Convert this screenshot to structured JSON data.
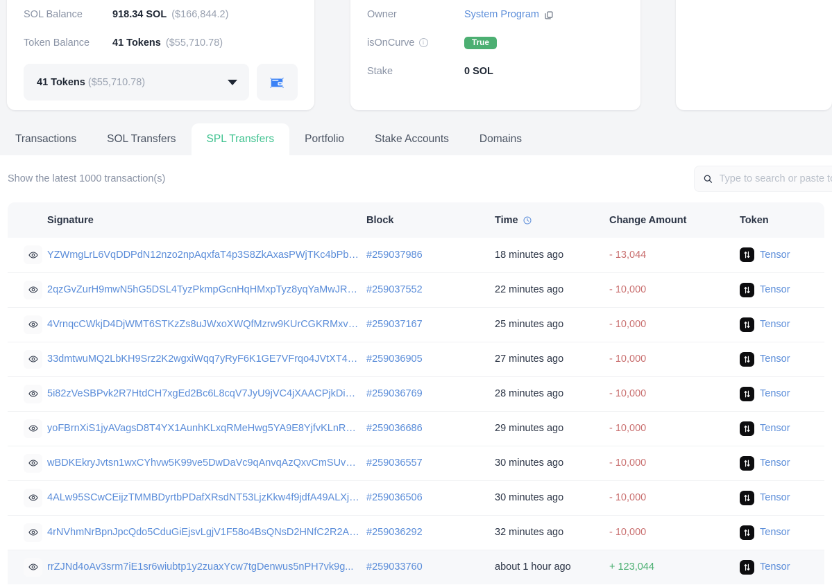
{
  "account_card": {
    "rows": [
      {
        "label": "SOL Balance",
        "value_strong": "918.34 SOL",
        "value_muted": "($166,844.2)"
      },
      {
        "label": "Token Balance",
        "value_strong": "41 Tokens",
        "value_muted": "($55,710.78)"
      }
    ],
    "token_selector": {
      "value_strong": "41 Tokens",
      "value_muted": "($55,710.78)",
      "caret_icon": "chevron-down-icon",
      "wallet_icon": "wallet-icon"
    }
  },
  "detail_card": {
    "owner_label": "Owner",
    "owner_value": "System Program",
    "owner_copy_icon": "copy-icon",
    "isoncurve_label": "isOnCurve",
    "isoncurve_info_icon": "info-icon",
    "isoncurve_value": "True",
    "stake_label": "Stake",
    "stake_value": "0 SOL"
  },
  "tabs": [
    {
      "label": "Transactions",
      "active": false
    },
    {
      "label": "SOL Transfers",
      "active": false
    },
    {
      "label": "SPL Transfers",
      "active": true
    },
    {
      "label": "Portfolio",
      "active": false
    },
    {
      "label": "Stake Accounts",
      "active": false
    },
    {
      "label": "Domains",
      "active": false
    }
  ],
  "toolbar": {
    "show_latest": "Show the latest 1000 transaction(s)",
    "search_placeholder": "Type to search or paste token address",
    "search_value": "",
    "search_icon": "search-icon"
  },
  "table": {
    "columns": [
      "",
      "Signature",
      "Block",
      "Time",
      "Change Amount",
      "Token"
    ],
    "time_sort_icon": "clock-icon",
    "row_eye_icon": "eye-icon",
    "rows": [
      {
        "signature": "YZWmgLrL6VqDDPdN12nzo2npAqxfaT4p3S8ZkAxasPWjTKc4bPbS...",
        "block": "#259037986",
        "time": "18 minutes ago",
        "amount": "- 13,044",
        "amount_sign": "neg",
        "token": "Tensor",
        "token_logo": "tensor-logo"
      },
      {
        "signature": "2qzGvZurH9mwN5hG5DSL4TyzPkmpGcnHqHMxpTyz8yqYaMwJR3...",
        "block": "#259037552",
        "time": "22 minutes ago",
        "amount": "- 10,000",
        "amount_sign": "neg",
        "token": "Tensor",
        "token_logo": "tensor-logo"
      },
      {
        "signature": "4VrnqcCWkjD4DjWMT6STKzZs8uJWxoXWQfMzrw9KUrCGKRMxvzi...",
        "block": "#259037167",
        "time": "25 minutes ago",
        "amount": "- 10,000",
        "amount_sign": "neg",
        "token": "Tensor",
        "token_logo": "tensor-logo"
      },
      {
        "signature": "33dmtwuMQ2LbKH9Srz2K2wgxiWqq7yRyF6K1GE7VFrqo4JVtXT4S...",
        "block": "#259036905",
        "time": "27 minutes ago",
        "amount": "- 10,000",
        "amount_sign": "neg",
        "token": "Tensor",
        "token_logo": "tensor-logo"
      },
      {
        "signature": "5i82zVeSBPvk2R7HtdCH7xgEd2Bc6L8cqV7JyU9jVC4jXAACPjkDiHs...",
        "block": "#259036769",
        "time": "28 minutes ago",
        "amount": "- 10,000",
        "amount_sign": "neg",
        "token": "Tensor",
        "token_logo": "tensor-logo"
      },
      {
        "signature": "yoFBrnXiS1jyAVagsD8T4YX1AunhKLxqRMeHwg5YA9E8YjfvKLnRPD...",
        "block": "#259036686",
        "time": "29 minutes ago",
        "amount": "- 10,000",
        "amount_sign": "neg",
        "token": "Tensor",
        "token_logo": "tensor-logo"
      },
      {
        "signature": "wBDKEkryJvtsn1wxCYhvw5K99ve5DwDaVc9qAnvqAzQxvCmSUvej6...",
        "block": "#259036557",
        "time": "30 minutes ago",
        "amount": "- 10,000",
        "amount_sign": "neg",
        "token": "Tensor",
        "token_logo": "tensor-logo"
      },
      {
        "signature": "4ALw95SCwCEijzTMMBDyrtbPDafXRsdNT53LjzKkw4f9jdfA49ALXjs...",
        "block": "#259036506",
        "time": "30 minutes ago",
        "amount": "- 10,000",
        "amount_sign": "neg",
        "token": "Tensor",
        "token_logo": "tensor-logo"
      },
      {
        "signature": "4rNVhmNrBpnJpcQdo5CduGiEjsvLgjV1F58o4BsQNsD2HNfC2R2Atb...",
        "block": "#259036292",
        "time": "32 minutes ago",
        "amount": "- 10,000",
        "amount_sign": "neg",
        "token": "Tensor",
        "token_logo": "tensor-logo"
      },
      {
        "signature": "rrZJNd4oAv3srm7iE1sr6wiubtp1y2zuaxYcw7tgDenwus5nPH7vk9g...",
        "block": "#259033760",
        "time": "about 1 hour ago",
        "amount": "+ 123,044",
        "amount_sign": "pos",
        "token": "Tensor",
        "token_logo": "tensor-logo"
      }
    ]
  },
  "colors": {
    "accent_green": "#3ec28f",
    "link_blue": "#5b8dd9",
    "badge_green": "#4caf72",
    "amount_negative": "#c96f6f",
    "amount_positive": "#4caf72",
    "page_bg": "#f4f5f7"
  }
}
